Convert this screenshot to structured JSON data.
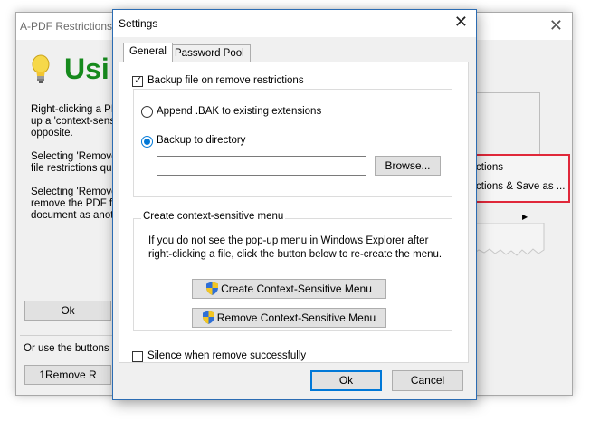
{
  "background_window": {
    "title": "A-PDF Restrictions R",
    "close_glyph": "✕",
    "heading": "Usi",
    "paragraphs": [
      [
        "Right-clicking a PD",
        "up a 'context-sensiti",
        "opposite."
      ],
      [
        "Selecting 'Remove",
        "file restrictions quic"
      ],
      [
        "Selecting 'Remove",
        "remove the PDF file",
        "document as anoth"
      ]
    ],
    "ok_label": "Ok",
    "note": "Or use the buttons be",
    "remove_button_label": "1Remove R",
    "context_menu": {
      "item1": "ctions",
      "item2": "ctions & Save as ...",
      "highlight_color": "#e0283a"
    },
    "heading_color": "#168a1d"
  },
  "dialog": {
    "title": "Settings",
    "close_glyph": "✕",
    "tabs": [
      {
        "label": "General",
        "active": true
      },
      {
        "label": "Password Pool",
        "active": false
      }
    ],
    "backup_checkbox": {
      "label": "Backup file on remove restrictions",
      "checked": true
    },
    "radio_append": {
      "label": "Append .BAK to existing extensions",
      "selected": false
    },
    "radio_directory": {
      "label": "Backup to directory",
      "selected": true
    },
    "directory_value": "",
    "browse_label": "Browse...",
    "context_group": {
      "title": "Create context-sensitive menu",
      "info_line1": "If you do not see the pop-up menu in Windows Explorer after",
      "info_line2": "right-clicking a file, click the button below to re-create the menu.",
      "create_label": "Create Context-Sensitive Menu",
      "remove_label": "Remove Context-Sensitive Menu"
    },
    "silence_checkbox": {
      "label": "Silence when remove successfully",
      "checked": false
    },
    "ok_label": "Ok",
    "cancel_label": "Cancel",
    "accent_color": "#0078d7"
  }
}
